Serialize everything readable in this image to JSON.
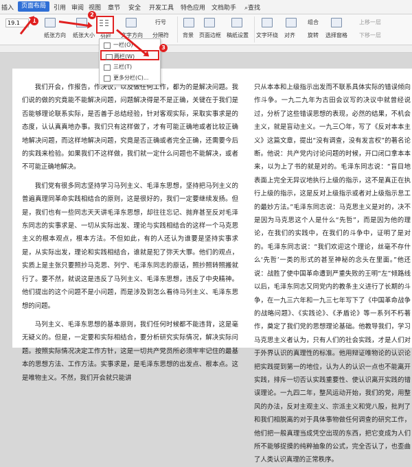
{
  "ribbon": {
    "tabs": [
      "插入",
      "页面布局",
      "引用",
      "审阅",
      "视图",
      "章节",
      "安全",
      "开发工具",
      "特色应用",
      "文档助手",
      "查找"
    ],
    "active_tab": "页面布局"
  },
  "toolbar": {
    "font_size": "19.1",
    "paper_direction": "纸张方向",
    "paper_size": "纸张大小",
    "columns": "分栏",
    "text_direction": "文字方向",
    "row_number": "行号",
    "separator": "分隔符",
    "background": "背景",
    "page_border": "页面边框",
    "draft": "稿纸设置",
    "text_wrap": "文字环绕",
    "align": "对齐",
    "rotate": "旋转",
    "group": "组合",
    "select_pane": "选择窗格",
    "up_layer": "上移一层",
    "down_layer": "下移一层"
  },
  "badges": [
    "1",
    "2",
    "3"
  ],
  "columns_menu": {
    "items": [
      "一栏(O)",
      "两栏(W)",
      "三栏(T)",
      "更多分栏(C)..."
    ],
    "selected": "两栏(W)"
  },
  "document": {
    "left_paragraphs": [
      "我们开会，作报告，作决议，以及做任何工作，都为的是解决问题。我们说的做的究竟能不能解决问题，问题解决得是不是正确，关键在于我们是否能够理论联系实际，是否善于总结经验，针对客观实际，采取实事求是的态度，认认真真地办事。我们只有这样做了，才有可能正确地或者比较正确地解决问题，而这样地解决问题，究竟是否正确或者完全正确，还需要今后的实践来检验。如果我们不这样做，我们就一定什么问题也不能解决，或者不可能正确地解决。",
      "我们党有很多同志坚持学习马列主义、毛泽东思想，坚持把马列主义的普遍真理同革命实践相结合的原则，这是很好的，我们一定要继续发扬。但是，我们也有一些同志天天讲毛泽东思想，却往往忘记、抛弃甚至反对毛泽东同志的实事求是、一切从实际出发、理论与实践相结合的这样一个马克思主义的根本观点，根本方法。不但如此，有的人还认为谁要是坚持实事求是，从实际出发，理论和实践相结合，谁就是犯了弥天大罪。他们的观点，实质上是主张只要照抄马克思、列宁、毛泽东同志的原话，照抄照转照搬就行了。要不然，就说这是违反了马列主义、毛泽东思想，违反了中央精神。他们提出的这个问题不是小问题，而是涉及到怎么看待马列主义、毛泽东思想的问题。",
      "马列主义、毛泽东思想的基本原则，我们任何时候都不能违背，这是毫无疑义的。但是，一定要和实际相结合，要分析研究实际情况，解决实际问题。按照实际情况决定工作方针，这是一切共产党员所必须牢牢记住的最基本的思想方法、工作方法。实事求是，是毛泽东思想的出发点、根本点。这是唯物主义。不然，我们开会就只能讲"
    ],
    "right_paragraphs": [
      "只从本本和上级指示出发而不联系具体实际的错误倾向作斗争。一九二九年为古田会议写的决议中就曾经说过，分析了这些错误思想的表现，必然的结果，不机会主义，就是盲动主义。一九三〇年，写了《反对本本主义》这篇文章，提出“没有调查，没有发言权”的著名论断。他说：共产党内讨论问题的时候，开口闭口拿本本来，以为上了书的就是对的。毛泽东同志说：“盲目地表面上完全无异议地执行上级的指示，这不是真正在执行上级的指示，这是反对上级指示或者对上级指示怠工的最妙方法。”毛泽东同志说：马克思主义是对的，决不是因为马克思这个人是什么“先哲”，而是因为他的理论，在我们的实践中，在我们的斗争中，证明了是对的。毛泽东同志说：“我们欢迎这个理论，丝毫不存什么‘先哲’一类的形式的甚至神秘的念头在里面。”他还说：战胜了使中国革命遭到严重失败的王明“左”倾路线以后，毛泽东同志又同党内的教条主义进行了长期的斗争，在一九三六年和一九三七年写下了《中国革命战争的战略问题》、《实践论》、《矛盾论》等一系列不朽著作，奠定了我们党的思想理论基础。他教导我们，学习马克思主义者认为，只有人们的社会实践，才是人们对于外界认识的真理性的标准。他用辩证唯物论的认识论把实践提到第一的地位，认为人的认识一点也不能离开实践，排斥一切否认实践重要性、使认识离开实践的错误理论。一九四二年，整风运动开始，我们的党，用整风的办法，反对主观主义、宗派主义和党八股，批判了和我们相脱离的对于具体事物做任何调查的研究工作，他们把一般真理当成凭空出现的东西，把它变成为人们所不能够捉摸的纯粹抽象的公式，完全否认了，也歪曲了人类认识真理的正常秩序。"
    ]
  }
}
